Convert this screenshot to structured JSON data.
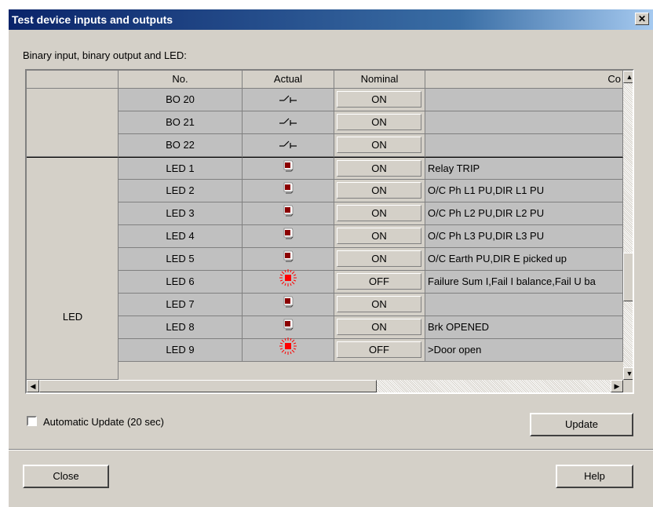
{
  "window": {
    "title": "Test device inputs and outputs",
    "close_glyph": "✕"
  },
  "group_label": "Binary input, binary output and LED:",
  "table": {
    "headers": {
      "no": "No.",
      "actual": "Actual",
      "nominal": "Nominal",
      "comment": "Co"
    },
    "groups": [
      {
        "label": ""
      },
      {
        "label": "LED"
      }
    ],
    "rows": [
      {
        "no": "BO 20",
        "actual_icon": "relay-contact-icon",
        "nominal": "ON",
        "comment": ""
      },
      {
        "no": "BO 21",
        "actual_icon": "relay-contact-icon",
        "nominal": "ON",
        "comment": ""
      },
      {
        "no": "BO 22",
        "actual_icon": "relay-contact-icon",
        "nominal": "ON",
        "comment": ""
      },
      {
        "no": "LED 1",
        "actual_icon": "led-off-icon",
        "nominal": "ON",
        "comment": "Relay TRIP"
      },
      {
        "no": "LED 2",
        "actual_icon": "led-off-icon",
        "nominal": "ON",
        "comment": "O/C Ph L1 PU,DIR L1 PU"
      },
      {
        "no": "LED 3",
        "actual_icon": "led-off-icon",
        "nominal": "ON",
        "comment": "O/C Ph L2 PU,DIR L2 PU"
      },
      {
        "no": "LED 4",
        "actual_icon": "led-off-icon",
        "nominal": "ON",
        "comment": "O/C Ph L3 PU,DIR L3 PU"
      },
      {
        "no": "LED 5",
        "actual_icon": "led-off-icon",
        "nominal": "ON",
        "comment": "O/C Earth PU,DIR E picked up"
      },
      {
        "no": "LED 6",
        "actual_icon": "led-lit-icon",
        "nominal": "OFF",
        "comment": "Failure Sum I,Fail I balance,Fail U ba"
      },
      {
        "no": "LED 7",
        "actual_icon": "led-off-icon",
        "nominal": "ON",
        "comment": ""
      },
      {
        "no": "LED 8",
        "actual_icon": "led-off-icon",
        "nominal": "ON",
        "comment": "Brk OPENED"
      },
      {
        "no": "LED 9",
        "actual_icon": "led-lit-icon",
        "nominal": "OFF",
        "comment": ">Door open"
      }
    ]
  },
  "auto_update": {
    "label": "Automatic Update (20 sec)",
    "checked": false
  },
  "buttons": {
    "update": "Update",
    "close": "Close",
    "help": "Help"
  },
  "colors": {
    "title_start": "#0a246a",
    "title_end": "#a6caf0",
    "led_dark": "#8b0000",
    "led_lit": "#ff0000",
    "cell_gray": "#c0c0c0",
    "face": "#d4d0c8"
  },
  "scroll": {
    "vertical_position": 0.72,
    "horizontal_position": 0.0
  }
}
